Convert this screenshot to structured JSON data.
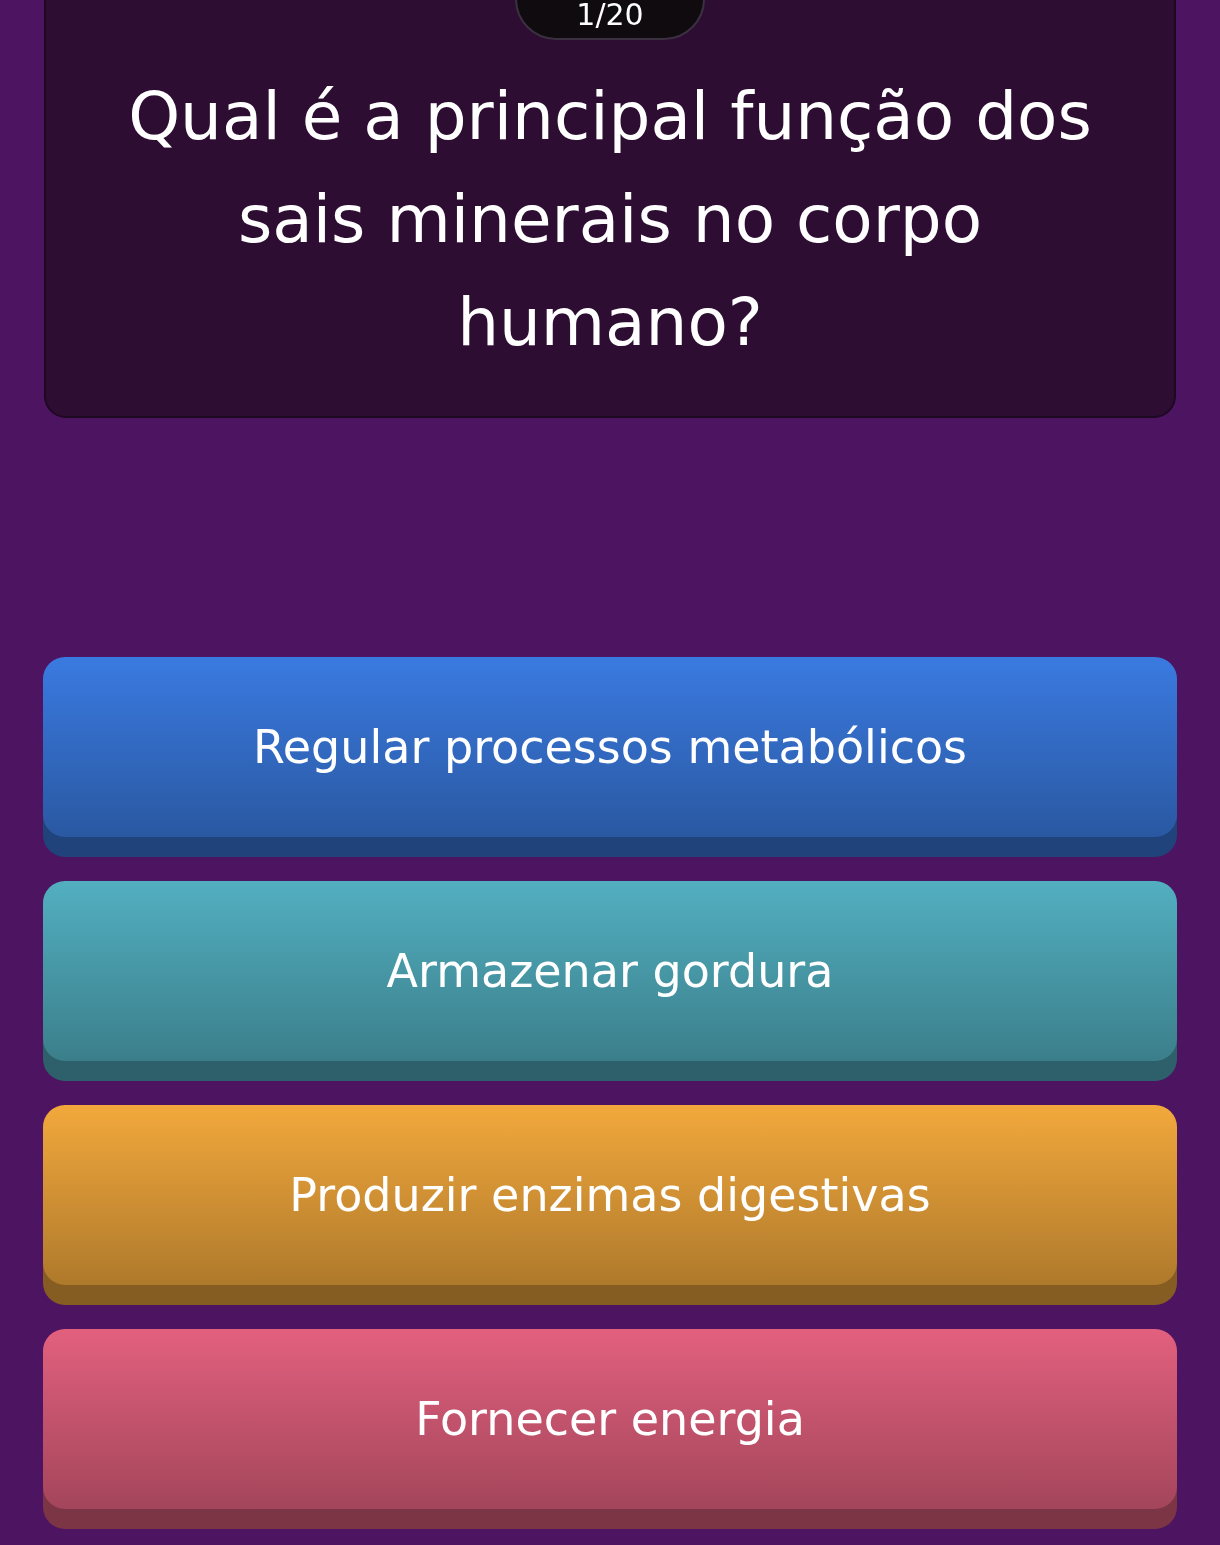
{
  "counter": "1/20",
  "question": "Qual é a principal função dos sais minerais no corpo humano?",
  "answers": [
    {
      "label": "Regular processos metabólicos",
      "color": "#3a7ae0"
    },
    {
      "label": "Armazenar gordura",
      "color": "#52afc0"
    },
    {
      "label": "Produzir enzimas digestivas",
      "color": "#f2a83c"
    },
    {
      "label": "Fornecer energia",
      "color": "#e2607e"
    }
  ]
}
